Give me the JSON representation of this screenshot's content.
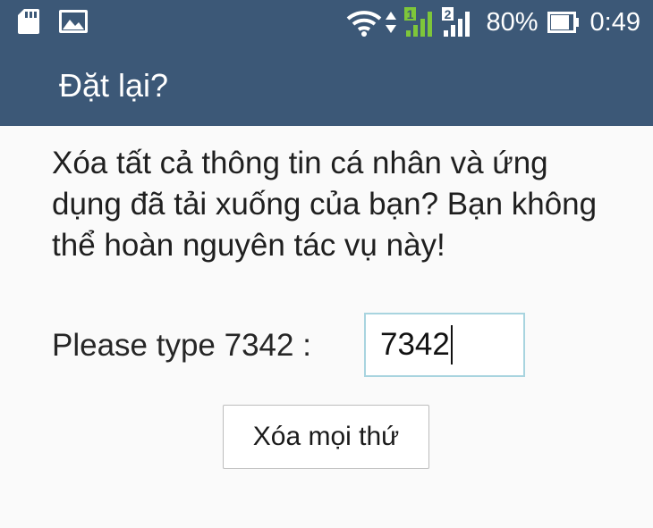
{
  "status_bar": {
    "icons": [
      "sd-card-icon",
      "image-icon",
      "wifi-icon",
      "data-arrows-icon",
      "sim1-signal-icon",
      "sim2-signal-icon",
      "battery-icon"
    ],
    "sim1_badge": "1",
    "sim2_badge": "2",
    "battery_level": "80%",
    "time": "0:49",
    "colors": {
      "sim1_signal": "#7ec63a",
      "icons": "#ffffff"
    }
  },
  "header": {
    "title": "Đặt lại?",
    "background": "#3c5877"
  },
  "dialog": {
    "message": "Xóa tất cả thông tin cá nhân và ứng dụng đã tải xuống của bạn? Bạn không thể hoàn nguyên tác vụ này!",
    "prompt_label": "Please type 7342 :",
    "code_value": "7342",
    "erase_button_label": "Xóa mọi thứ"
  }
}
